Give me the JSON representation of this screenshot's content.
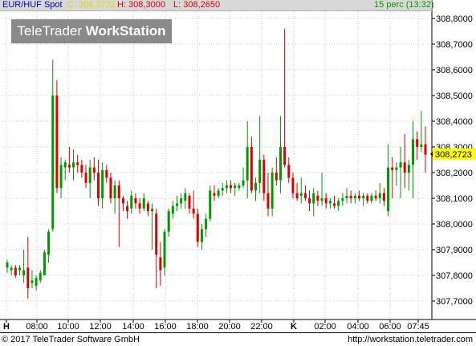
{
  "header": {
    "instrument": "EUR/HUF Spot",
    "close": "C: 308,2722",
    "high": "H: 308,3000",
    "low": "L: 308,2650",
    "interval": "15 perc (13:32)"
  },
  "watermark": {
    "part1": "TeleTrader ",
    "part2": "WorkStation"
  },
  "footer": {
    "copyright": "© 2017  TeleTrader Software GmbH",
    "url": "http://workstation.teletrader.com"
  },
  "colors": {
    "up": "#009900",
    "down": "#dd0000",
    "grid": "#cccccc",
    "last_price_bg": "#ffff00",
    "header_bg": "#d8d8d8"
  },
  "chart_data": {
    "type": "candlestick",
    "title": "EUR/HUF Spot",
    "ylim": [
      307.65,
      308.85
    ],
    "y_ticks": [
      "308,8000",
      "308,7000",
      "308,6000",
      "308,5000",
      "308,4000",
      "308,3000",
      "308,2000",
      "308,1000",
      "308,0000",
      "307,9000",
      "307,8000",
      "307,7000"
    ],
    "y_tick_values": [
      308.8,
      308.7,
      308.6,
      308.5,
      308.4,
      308.3,
      308.2,
      308.1,
      308.0,
      307.9,
      307.8,
      307.7
    ],
    "x_ticks": [
      "H",
      "08:00",
      "10:00",
      "12:00",
      "14:00",
      "16:00",
      "18:00",
      "20:00",
      "22:00",
      "K",
      "02:00",
      "04:00",
      "06:00",
      "07:45"
    ],
    "last_price": "308,2723",
    "grid": true,
    "candles": [
      {
        "t": "06:30",
        "o": 307.83,
        "h": 307.86,
        "l": 307.81,
        "c": 307.85
      },
      {
        "t": "06:45",
        "o": 307.82,
        "h": 307.84,
        "l": 307.8,
        "c": 307.83
      },
      {
        "t": "07:00",
        "o": 307.83,
        "h": 307.84,
        "l": 307.79,
        "c": 307.8
      },
      {
        "t": "07:15",
        "o": 307.82,
        "h": 307.84,
        "l": 307.8,
        "c": 307.83
      },
      {
        "t": "07:30",
        "o": 307.8,
        "h": 307.9,
        "l": 307.77,
        "c": 307.82
      },
      {
        "t": "07:45",
        "o": 307.83,
        "h": 307.95,
        "l": 307.71,
        "c": 307.75
      },
      {
        "t": "08:00",
        "o": 307.77,
        "h": 307.82,
        "l": 307.75,
        "c": 307.78
      },
      {
        "t": "08:15",
        "o": 307.76,
        "h": 307.8,
        "l": 307.74,
        "c": 307.79
      },
      {
        "t": "08:30",
        "o": 307.78,
        "h": 307.82,
        "l": 307.77,
        "c": 307.81
      },
      {
        "t": "08:45",
        "o": 307.8,
        "h": 307.9,
        "l": 307.8,
        "c": 307.89
      },
      {
        "t": "09:00",
        "o": 307.88,
        "h": 307.98,
        "l": 307.85,
        "c": 307.97
      },
      {
        "t": "09:15",
        "o": 307.98,
        "h": 308.64,
        "l": 307.97,
        "c": 308.5
      },
      {
        "t": "09:30",
        "o": 308.5,
        "h": 308.56,
        "l": 308.12,
        "c": 308.14
      },
      {
        "t": "09:45",
        "o": 308.14,
        "h": 308.26,
        "l": 308.1,
        "c": 308.23
      },
      {
        "t": "10:00",
        "o": 308.22,
        "h": 308.25,
        "l": 308.17,
        "c": 308.24
      },
      {
        "t": "10:15",
        "o": 308.23,
        "h": 308.3,
        "l": 308.2,
        "c": 308.22
      },
      {
        "t": "10:30",
        "o": 308.22,
        "h": 308.29,
        "l": 308.17,
        "c": 308.24
      },
      {
        "t": "10:45",
        "o": 308.24,
        "h": 308.27,
        "l": 308.2,
        "c": 308.23
      },
      {
        "t": "11:00",
        "o": 308.23,
        "h": 308.25,
        "l": 308.18,
        "c": 308.2
      },
      {
        "t": "11:15",
        "o": 308.2,
        "h": 308.23,
        "l": 308.14,
        "c": 308.16
      },
      {
        "t": "11:30",
        "o": 308.16,
        "h": 308.25,
        "l": 308.1,
        "c": 308.22
      },
      {
        "t": "11:45",
        "o": 308.22,
        "h": 308.26,
        "l": 308.17,
        "c": 308.2
      },
      {
        "t": "12:00",
        "o": 308.2,
        "h": 308.25,
        "l": 308.07,
        "c": 308.1
      },
      {
        "t": "12:15",
        "o": 308.1,
        "h": 308.24,
        "l": 308.06,
        "c": 308.21
      },
      {
        "t": "12:30",
        "o": 308.21,
        "h": 308.23,
        "l": 308.16,
        "c": 308.18
      },
      {
        "t": "12:45",
        "o": 308.18,
        "h": 308.2,
        "l": 308.08,
        "c": 308.1
      },
      {
        "t": "13:00",
        "o": 308.1,
        "h": 308.17,
        "l": 308.04,
        "c": 308.15
      },
      {
        "t": "13:15",
        "o": 308.15,
        "h": 308.17,
        "l": 307.91,
        "c": 308.1
      },
      {
        "t": "13:30",
        "o": 308.1,
        "h": 308.11,
        "l": 308.05,
        "c": 308.08
      },
      {
        "t": "13:45",
        "o": 308.07,
        "h": 308.09,
        "l": 308.02,
        "c": 308.05
      },
      {
        "t": "14:00",
        "o": 308.06,
        "h": 308.13,
        "l": 308.04,
        "c": 308.11
      },
      {
        "t": "14:15",
        "o": 308.1,
        "h": 308.12,
        "l": 308.06,
        "c": 308.08
      },
      {
        "t": "14:30",
        "o": 308.08,
        "h": 308.1,
        "l": 308.04,
        "c": 308.06
      },
      {
        "t": "14:45",
        "o": 308.06,
        "h": 308.12,
        "l": 308.05,
        "c": 308.1
      },
      {
        "t": "15:00",
        "o": 308.08,
        "h": 308.09,
        "l": 308.03,
        "c": 308.05
      },
      {
        "t": "15:15",
        "o": 308.05,
        "h": 308.08,
        "l": 307.9,
        "c": 308.06
      },
      {
        "t": "15:30",
        "o": 308.04,
        "h": 308.06,
        "l": 307.75,
        "c": 307.88
      },
      {
        "t": "15:45",
        "o": 307.87,
        "h": 307.93,
        "l": 307.76,
        "c": 307.82
      },
      {
        "t": "16:00",
        "o": 307.83,
        "h": 307.98,
        "l": 307.8,
        "c": 307.97
      },
      {
        "t": "16:15",
        "o": 307.97,
        "h": 308.06,
        "l": 307.95,
        "c": 308.05
      },
      {
        "t": "16:30",
        "o": 308.04,
        "h": 308.09,
        "l": 308.02,
        "c": 308.07
      },
      {
        "t": "16:45",
        "o": 308.07,
        "h": 308.11,
        "l": 308.05,
        "c": 308.08
      },
      {
        "t": "17:00",
        "o": 308.08,
        "h": 308.12,
        "l": 308.06,
        "c": 308.1
      },
      {
        "t": "17:15",
        "o": 308.09,
        "h": 308.14,
        "l": 308.06,
        "c": 308.12
      },
      {
        "t": "17:30",
        "o": 308.11,
        "h": 308.12,
        "l": 308.04,
        "c": 308.06
      },
      {
        "t": "17:45",
        "o": 308.06,
        "h": 308.13,
        "l": 308.02,
        "c": 308.04
      },
      {
        "t": "18:00",
        "o": 308.04,
        "h": 308.06,
        "l": 307.91,
        "c": 307.93
      },
      {
        "t": "18:15",
        "o": 307.93,
        "h": 308.0,
        "l": 307.9,
        "c": 307.98
      },
      {
        "t": "18:30",
        "o": 307.98,
        "h": 308.04,
        "l": 307.95,
        "c": 308.02
      },
      {
        "t": "18:45",
        "o": 308.02,
        "h": 308.15,
        "l": 308.01,
        "c": 308.13
      },
      {
        "t": "19:00",
        "o": 308.12,
        "h": 308.15,
        "l": 308.09,
        "c": 308.11
      },
      {
        "t": "19:15",
        "o": 308.11,
        "h": 308.14,
        "l": 308.1,
        "c": 308.13
      },
      {
        "t": "19:30",
        "o": 308.13,
        "h": 308.16,
        "l": 308.11,
        "c": 308.14
      },
      {
        "t": "19:45",
        "o": 308.14,
        "h": 308.17,
        "l": 308.12,
        "c": 308.15
      },
      {
        "t": "20:00",
        "o": 308.15,
        "h": 308.17,
        "l": 308.12,
        "c": 308.14
      },
      {
        "t": "20:15",
        "o": 308.14,
        "h": 308.16,
        "l": 308.11,
        "c": 308.15
      },
      {
        "t": "20:30",
        "o": 308.14,
        "h": 308.16,
        "l": 308.13,
        "c": 308.15
      },
      {
        "t": "20:45",
        "o": 308.15,
        "h": 308.22,
        "l": 308.14,
        "c": 308.17
      },
      {
        "t": "21:00",
        "o": 308.17,
        "h": 308.4,
        "l": 308.1,
        "c": 308.3
      },
      {
        "t": "21:15",
        "o": 308.3,
        "h": 308.34,
        "l": 308.12,
        "c": 308.13
      },
      {
        "t": "21:30",
        "o": 308.13,
        "h": 308.18,
        "l": 308.09,
        "c": 308.16
      },
      {
        "t": "21:45",
        "o": 308.16,
        "h": 308.42,
        "l": 308.12,
        "c": 308.25
      },
      {
        "t": "22:00",
        "o": 308.25,
        "h": 308.27,
        "l": 308.09,
        "c": 308.12
      },
      {
        "t": "22:15",
        "o": 308.12,
        "h": 308.2,
        "l": 308.03,
        "c": 308.06
      },
      {
        "t": "22:30",
        "o": 308.06,
        "h": 308.22,
        "l": 308.03,
        "c": 308.2
      },
      {
        "t": "22:45",
        "o": 308.2,
        "h": 308.26,
        "l": 308.15,
        "c": 308.17
      },
      {
        "t": "23:00",
        "o": 308.17,
        "h": 308.42,
        "l": 308.12,
        "c": 308.3
      },
      {
        "t": "23:15",
        "o": 308.3,
        "h": 308.76,
        "l": 308.22,
        "c": 308.23
      },
      {
        "t": "23:30",
        "o": 308.23,
        "h": 308.26,
        "l": 308.16,
        "c": 308.18
      },
      {
        "t": "23:45",
        "o": 308.18,
        "h": 308.2,
        "l": 308.1,
        "c": 308.12
      },
      {
        "t": "00:00",
        "o": 308.12,
        "h": 308.16,
        "l": 308.09,
        "c": 308.1
      },
      {
        "t": "00:15",
        "o": 308.11,
        "h": 308.18,
        "l": 308.08,
        "c": 308.12
      },
      {
        "t": "00:30",
        "o": 308.12,
        "h": 308.15,
        "l": 308.09,
        "c": 308.1
      },
      {
        "t": "00:45",
        "o": 308.1,
        "h": 308.13,
        "l": 308.05,
        "c": 308.08
      },
      {
        "t": "01:00",
        "o": 308.08,
        "h": 308.14,
        "l": 308.03,
        "c": 308.12
      },
      {
        "t": "01:15",
        "o": 308.11,
        "h": 308.13,
        "l": 308.07,
        "c": 308.09
      },
      {
        "t": "01:30",
        "o": 308.09,
        "h": 308.2,
        "l": 308.07,
        "c": 308.1
      },
      {
        "t": "01:45",
        "o": 308.1,
        "h": 308.12,
        "l": 308.06,
        "c": 308.08
      },
      {
        "t": "02:00",
        "o": 308.08,
        "h": 308.1,
        "l": 308.06,
        "c": 308.09
      },
      {
        "t": "02:15",
        "o": 308.08,
        "h": 308.11,
        "l": 308.06,
        "c": 308.07
      },
      {
        "t": "02:30",
        "o": 308.07,
        "h": 308.1,
        "l": 308.05,
        "c": 308.09
      },
      {
        "t": "02:45",
        "o": 308.09,
        "h": 308.12,
        "l": 308.07,
        "c": 308.1
      },
      {
        "t": "03:00",
        "o": 308.1,
        "h": 308.14,
        "l": 308.08,
        "c": 308.11
      },
      {
        "t": "03:15",
        "o": 308.11,
        "h": 308.13,
        "l": 308.08,
        "c": 308.1
      },
      {
        "t": "03:30",
        "o": 308.1,
        "h": 308.12,
        "l": 308.08,
        "c": 308.11
      },
      {
        "t": "03:45",
        "o": 308.11,
        "h": 308.13,
        "l": 308.09,
        "c": 308.1
      },
      {
        "t": "04:00",
        "o": 308.1,
        "h": 308.12,
        "l": 308.07,
        "c": 308.11
      },
      {
        "t": "04:15",
        "o": 308.11,
        "h": 308.12,
        "l": 308.08,
        "c": 308.09
      },
      {
        "t": "04:30",
        "o": 308.09,
        "h": 308.12,
        "l": 308.08,
        "c": 308.11
      },
      {
        "t": "04:45",
        "o": 308.11,
        "h": 308.13,
        "l": 308.09,
        "c": 308.1
      },
      {
        "t": "05:00",
        "o": 308.1,
        "h": 308.16,
        "l": 308.08,
        "c": 308.12
      },
      {
        "t": "05:15",
        "o": 308.12,
        "h": 308.14,
        "l": 308.07,
        "c": 308.09
      },
      {
        "t": "05:30",
        "o": 308.05,
        "h": 308.31,
        "l": 308.03,
        "c": 308.22
      },
      {
        "t": "05:45",
        "o": 308.22,
        "h": 308.26,
        "l": 308.1,
        "c": 308.21
      },
      {
        "t": "06:00",
        "o": 308.21,
        "h": 308.24,
        "l": 308.15,
        "c": 308.22
      },
      {
        "t": "06:15",
        "o": 308.22,
        "h": 308.3,
        "l": 308.1,
        "c": 308.24
      },
      {
        "t": "06:30",
        "o": 308.24,
        "h": 308.35,
        "l": 308.14,
        "c": 308.2
      },
      {
        "t": "06:45",
        "o": 308.2,
        "h": 308.25,
        "l": 308.13,
        "c": 308.23
      },
      {
        "t": "07:00",
        "o": 308.23,
        "h": 308.4,
        "l": 308.1,
        "c": 308.33
      },
      {
        "t": "07:15",
        "o": 308.33,
        "h": 308.36,
        "l": 308.25,
        "c": 308.3
      },
      {
        "t": "07:30",
        "o": 308.3,
        "h": 308.44,
        "l": 308.28,
        "c": 308.31
      },
      {
        "t": "07:45",
        "o": 308.31,
        "h": 308.38,
        "l": 308.2,
        "c": 308.27
      }
    ]
  }
}
